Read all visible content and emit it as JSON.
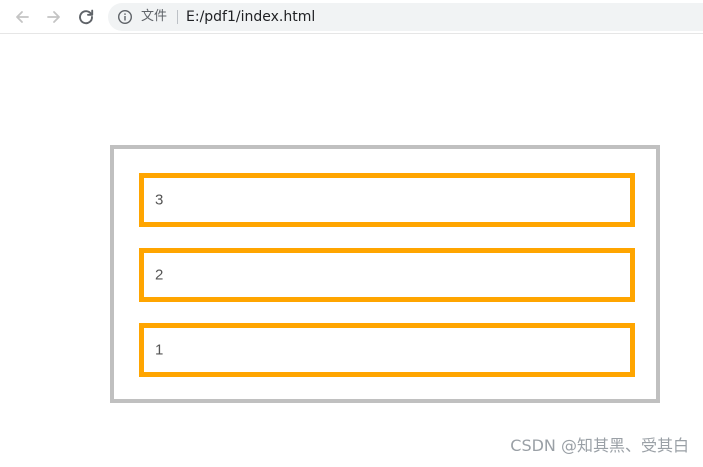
{
  "browser": {
    "file_label": "文件",
    "url": "E:/pdf1/index.html",
    "icons": {
      "back": "back-arrow-icon",
      "forward": "forward-arrow-icon",
      "reload": "reload-icon",
      "info": "info-icon"
    }
  },
  "page": {
    "items": [
      {
        "label": "3"
      },
      {
        "label": "2"
      },
      {
        "label": "1"
      }
    ],
    "colors": {
      "outer_border": "#c0c0c0",
      "item_border": "#ffa500"
    }
  },
  "watermark": "CSDN @知其黑、受其白"
}
